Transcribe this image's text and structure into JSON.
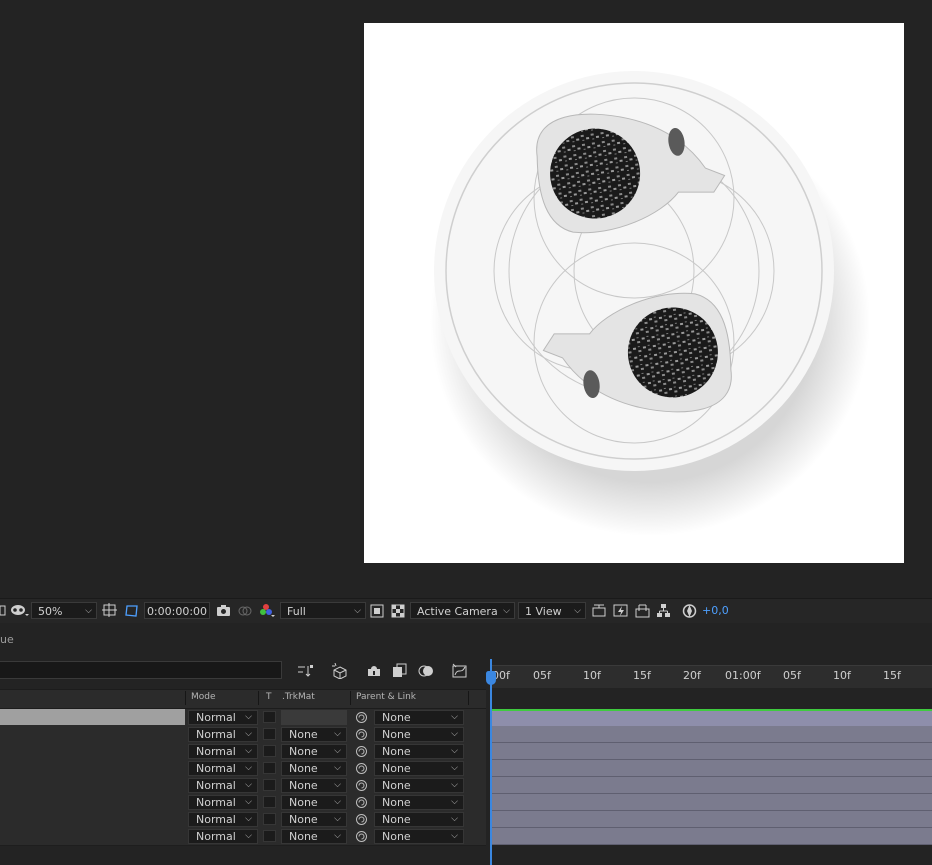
{
  "viewer_toolbar": {
    "zoom": "50%",
    "timecode": "0:00:00:00",
    "resolution": "Full",
    "camera": "Active Camera",
    "views": "1 View",
    "exposure": "+0,0",
    "accent_color": "#4ea0ff"
  },
  "timeline": {
    "tab_label": "ue",
    "columns": {
      "mode": "Mode",
      "t": "T",
      "trkmat": ".TrkMat",
      "parent": "Parent & Link"
    },
    "rows": [
      {
        "mode": "Normal",
        "trkmat": "",
        "parent": "None",
        "selected": true
      },
      {
        "mode": "Normal",
        "trkmat": "None",
        "parent": "None"
      },
      {
        "mode": "Normal",
        "trkmat": "None",
        "parent": "None"
      },
      {
        "mode": "Normal",
        "trkmat": "None",
        "parent": "None"
      },
      {
        "mode": "Normal",
        "trkmat": "None",
        "parent": "None"
      },
      {
        "mode": "Normal",
        "trkmat": "None",
        "parent": "None"
      },
      {
        "mode": "Normal",
        "trkmat": "None",
        "parent": "None"
      },
      {
        "mode": "Normal",
        "trkmat": "None",
        "parent": "None"
      }
    ],
    "ruler_labels": [
      "00f",
      "05f",
      "10f",
      "15f",
      "20f",
      "01:00f",
      "05f",
      "10f",
      "15f"
    ],
    "layer_bar_color": "#7b7b8e",
    "playhead_color": "#3b87e0"
  }
}
